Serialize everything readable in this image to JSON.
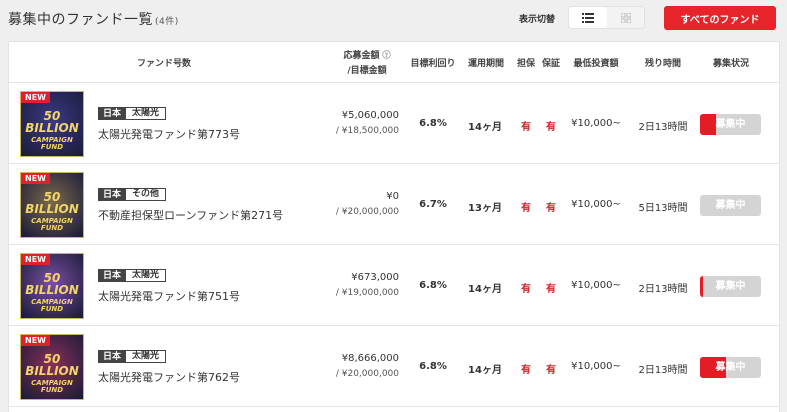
{
  "page": {
    "title": "募集中のファンド一覧",
    "count": "(4件)",
    "toggle_label": "表示切替",
    "all_funds_button": "すべてのファンド"
  },
  "columns": {
    "fund_name": "ファンド号数",
    "applied_amount": "応募金額",
    "target_amount": "/目標金額",
    "target_yield": "目標利回り",
    "term": "運用期間",
    "collateral": "担保",
    "guarantee": "保証",
    "min_investment": "最低投資額",
    "time_remaining": "残り時間",
    "status": "募集状況"
  },
  "funds": [
    {
      "badge": "NEW",
      "thumb_line1": "50 BILLION",
      "thumb_line2": "CAMPAIGN FUND",
      "tag_region": "日本",
      "tag_type": "太陽光",
      "name": "太陽光発電ファンド第773号",
      "applied": "¥5,060,000",
      "target": "/ ¥18,500,000",
      "yield": "6.8%",
      "term": "14ヶ月",
      "collateral": "有",
      "guarantee": "有",
      "min_investment": "¥10,000~",
      "remaining": "2日13時間",
      "status": "募集中",
      "progress": 0.27,
      "thumb_color": "#3b3a86"
    },
    {
      "badge": "NEW",
      "thumb_line1": "50 BILLION",
      "thumb_line2": "CAMPAIGN FUND",
      "tag_region": "日本",
      "tag_type": "その他",
      "name": "不動産担保型ローンファンド第271号",
      "applied": "¥0",
      "target": "/ ¥20,000,000",
      "yield": "6.7%",
      "term": "13ヶ月",
      "collateral": "有",
      "guarantee": "有",
      "min_investment": "¥10,000~",
      "remaining": "5日13時間",
      "status": "募集中",
      "progress": 0,
      "thumb_color": "#7a6a4a"
    },
    {
      "badge": "NEW",
      "thumb_line1": "50 BILLION",
      "thumb_line2": "CAMPAIGN FUND",
      "tag_region": "日本",
      "tag_type": "太陽光",
      "name": "太陽光発電ファンド第751号",
      "applied": "¥673,000",
      "target": "/ ¥19,000,000",
      "yield": "6.8%",
      "term": "14ヶ月",
      "collateral": "有",
      "guarantee": "有",
      "min_investment": "¥10,000~",
      "remaining": "2日13時間",
      "status": "募集中",
      "progress": 0.035,
      "thumb_color": "#7b4fa3"
    },
    {
      "badge": "NEW",
      "thumb_line1": "50 BILLION",
      "thumb_line2": "CAMPAIGN FUND",
      "tag_region": "日本",
      "tag_type": "太陽光",
      "name": "太陽光発電ファンド第762号",
      "applied": "¥8,666,000",
      "target": "/ ¥20,000,000",
      "yield": "6.8%",
      "term": "14ヶ月",
      "collateral": "有",
      "guarantee": "有",
      "min_investment": "¥10,000~",
      "remaining": "2日13時間",
      "status": "募集中",
      "progress": 0.43,
      "thumb_color": "#8a2f5a"
    }
  ]
}
